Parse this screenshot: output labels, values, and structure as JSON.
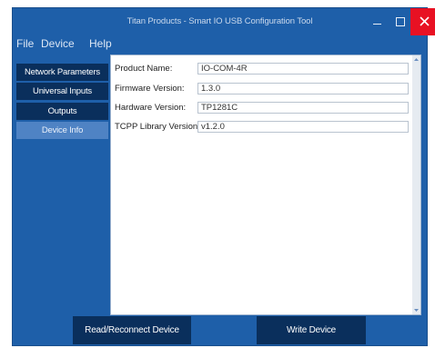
{
  "window": {
    "title": "Titan Products - Smart IO USB Configuration Tool"
  },
  "menu": [
    "File",
    "Device",
    "Help"
  ],
  "sidebar": {
    "items": [
      {
        "label": "Network Parameters",
        "active": false
      },
      {
        "label": "Universal Inputs",
        "active": false
      },
      {
        "label": "Outputs",
        "active": false
      },
      {
        "label": "Device Info",
        "active": true
      }
    ]
  },
  "device_info": {
    "fields": [
      {
        "label": "Product Name:",
        "value": "IO-COM-4R"
      },
      {
        "label": "Firmware Version:",
        "value": "1.3.0"
      },
      {
        "label": "Hardware Version:",
        "value": "TP1281C"
      },
      {
        "label": "TCPP Library Version:",
        "value": "v1.2.0"
      }
    ]
  },
  "buttons": {
    "read": "Read/Reconnect Device",
    "write": "Write Device"
  },
  "colors": {
    "chrome": "#1e5fa9",
    "dark_tab": "#0a2f5c",
    "active_tab": "#4f83c4",
    "close": "#e81123"
  }
}
